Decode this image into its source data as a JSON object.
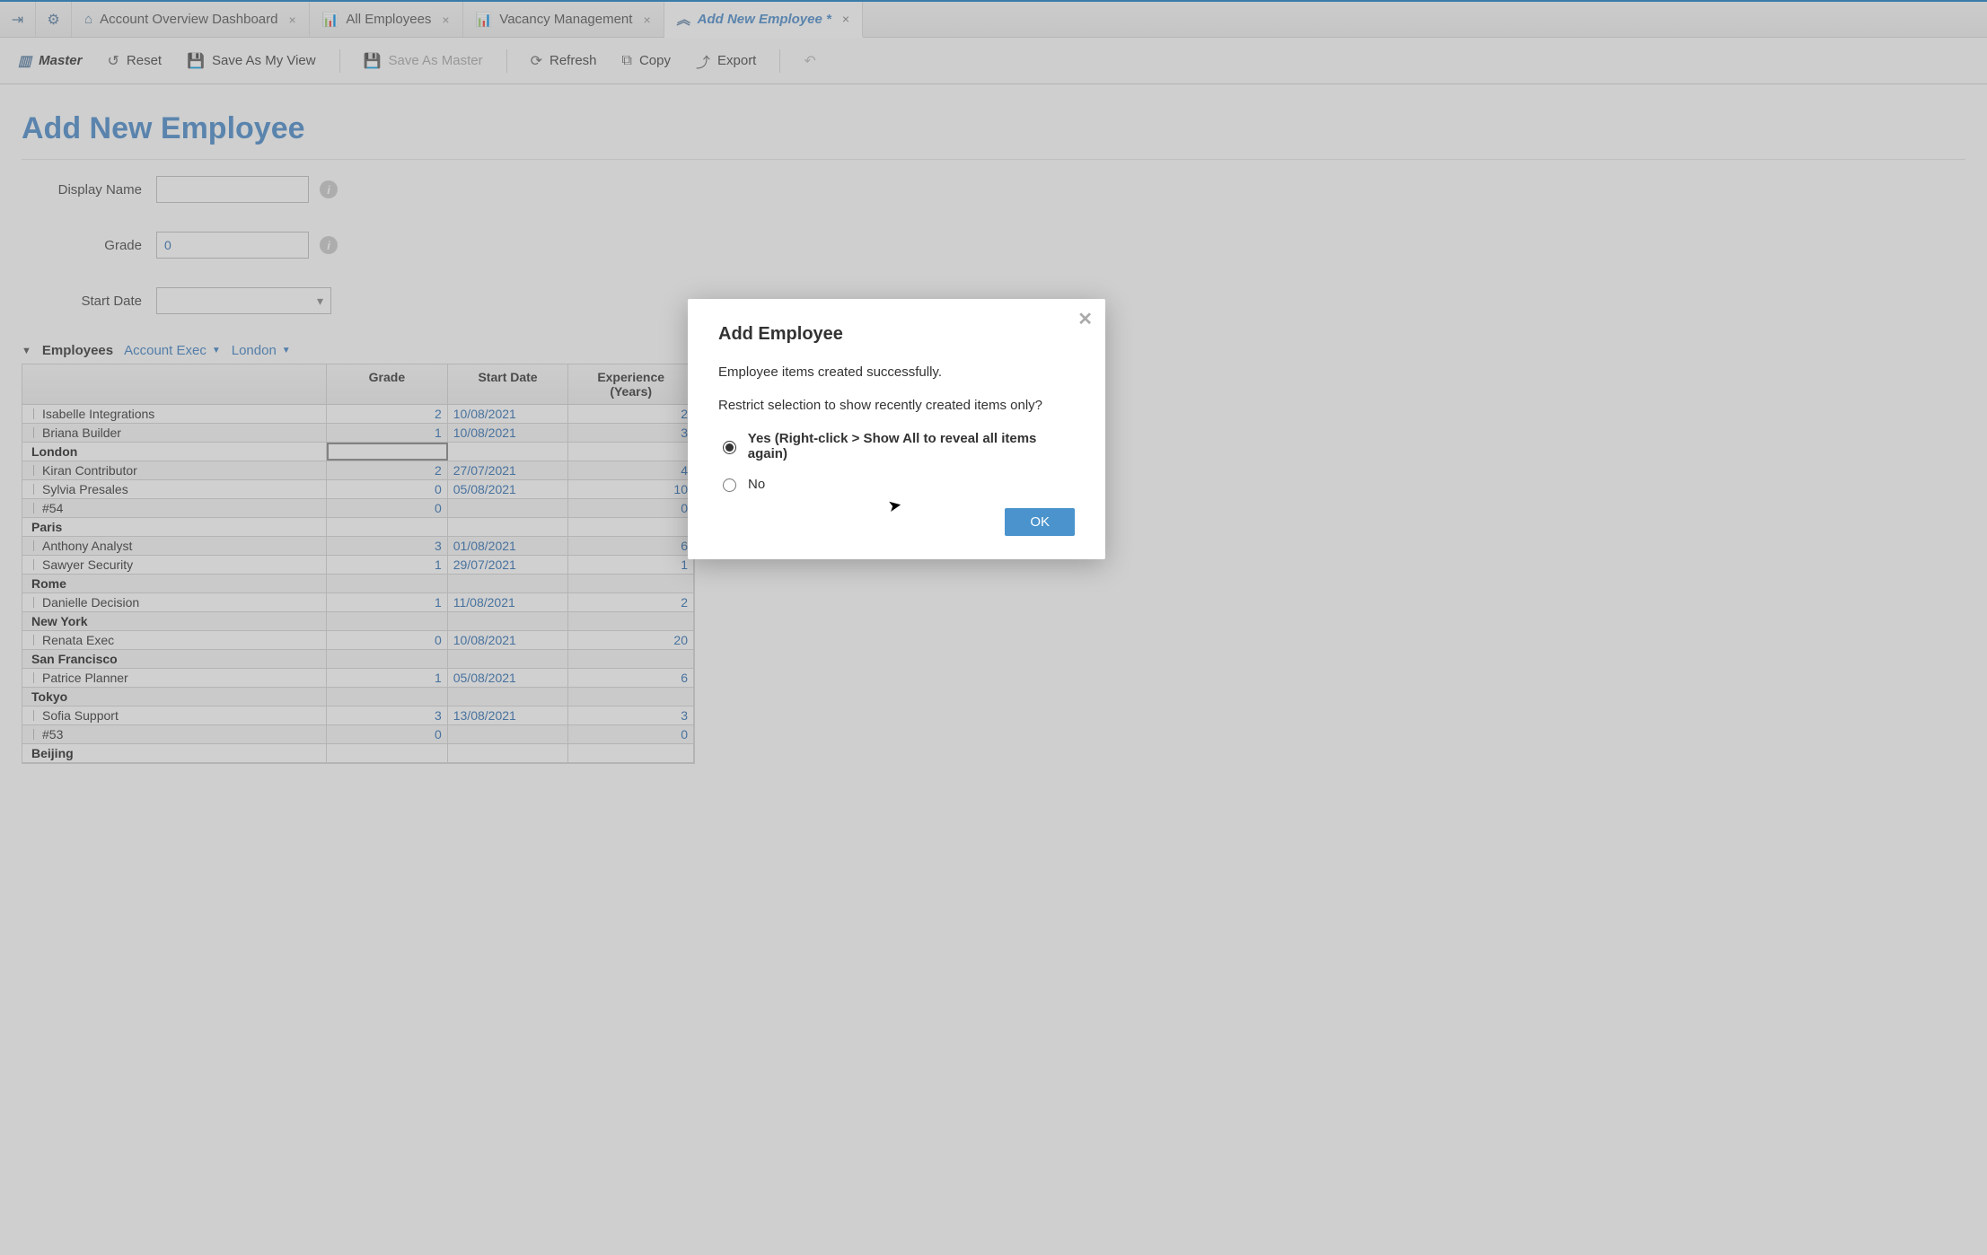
{
  "tabs": [
    {
      "icon": "⌂",
      "label": "Account Overview Dashboard",
      "active": false
    },
    {
      "icon": "📊",
      "label": "All Employees",
      "active": false
    },
    {
      "icon": "📊",
      "label": "Vacancy Management",
      "active": false
    },
    {
      "icon": "︽",
      "label": "Add New Employee *",
      "active": true
    }
  ],
  "toolbar": {
    "master": "Master",
    "reset": "Reset",
    "save_view": "Save As My View",
    "save_master": "Save As Master",
    "refresh": "Refresh",
    "copy": "Copy",
    "export": "Export"
  },
  "page_title": "Add New Employee",
  "form": {
    "display_name": {
      "label": "Display Name",
      "value": ""
    },
    "grade": {
      "label": "Grade",
      "value": "0"
    },
    "start_date": {
      "label": "Start Date",
      "value": ""
    }
  },
  "section": {
    "caret": "▼",
    "title": "Employees",
    "filter1": "Account Exec",
    "filter2": "London"
  },
  "grid": {
    "headers": {
      "name": "",
      "grade": "Grade",
      "date": "Start Date",
      "exp": "Experience (Years)"
    },
    "rows": [
      {
        "type": "data",
        "name": "Isabelle Integrations",
        "grade": "2",
        "date": "10/08/2021",
        "exp": "2"
      },
      {
        "type": "data",
        "name": "Briana Builder",
        "grade": "1",
        "date": "10/08/2021",
        "exp": "3"
      },
      {
        "type": "group",
        "name": "London",
        "selected": true
      },
      {
        "type": "data",
        "name": "Kiran Contributor",
        "grade": "2",
        "date": "27/07/2021",
        "exp": "4"
      },
      {
        "type": "data",
        "name": "Sylvia Presales",
        "grade": "0",
        "date": "05/08/2021",
        "exp": "10"
      },
      {
        "type": "data",
        "name": "#54",
        "grade": "0",
        "date": "",
        "exp": "0"
      },
      {
        "type": "group",
        "name": "Paris"
      },
      {
        "type": "data",
        "name": "Anthony Analyst",
        "grade": "3",
        "date": "01/08/2021",
        "exp": "6"
      },
      {
        "type": "data",
        "name": "Sawyer Security",
        "grade": "1",
        "date": "29/07/2021",
        "exp": "1"
      },
      {
        "type": "group",
        "name": "Rome"
      },
      {
        "type": "data",
        "name": "Danielle Decision",
        "grade": "1",
        "date": "11/08/2021",
        "exp": "2"
      },
      {
        "type": "group",
        "name": "New York"
      },
      {
        "type": "data",
        "name": "Renata Exec",
        "grade": "0",
        "date": "10/08/2021",
        "exp": "20"
      },
      {
        "type": "group",
        "name": "San Francisco"
      },
      {
        "type": "data",
        "name": "Patrice Planner",
        "grade": "1",
        "date": "05/08/2021",
        "exp": "6"
      },
      {
        "type": "group",
        "name": "Tokyo"
      },
      {
        "type": "data",
        "name": "Sofia Support",
        "grade": "3",
        "date": "13/08/2021",
        "exp": "3"
      },
      {
        "type": "data",
        "name": "#53",
        "grade": "0",
        "date": "",
        "exp": "0"
      },
      {
        "type": "group",
        "name": "Beijing"
      }
    ]
  },
  "modal": {
    "title": "Add Employee",
    "message": "Employee items created successfully.",
    "question": "Restrict selection to show recently created items only?",
    "opt_yes": "Yes (Right-click > Show All to reveal all items again)",
    "opt_no": "No",
    "ok": "OK"
  }
}
